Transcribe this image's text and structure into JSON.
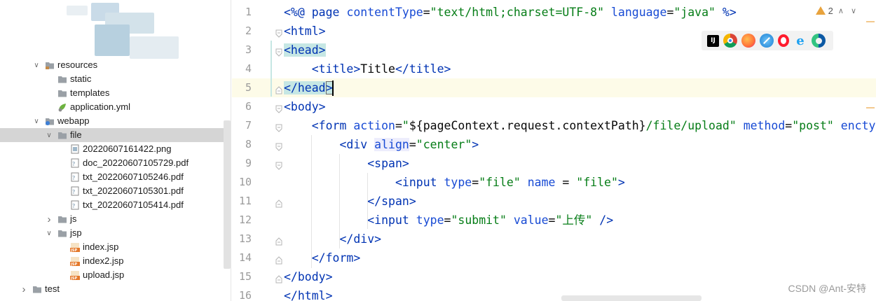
{
  "tree": {
    "items": [
      {
        "label": "resources",
        "indent": 1,
        "expanded": true,
        "kind": "folder-res"
      },
      {
        "label": "static",
        "indent": 2,
        "expanded": null,
        "kind": "folder"
      },
      {
        "label": "templates",
        "indent": 2,
        "expanded": null,
        "kind": "folder"
      },
      {
        "label": "application.yml",
        "indent": 2,
        "expanded": null,
        "kind": "yml"
      },
      {
        "label": "webapp",
        "indent": 1,
        "expanded": true,
        "kind": "folder-web"
      },
      {
        "label": "file",
        "indent": 2,
        "expanded": true,
        "kind": "folder",
        "selected": true
      },
      {
        "label": "20220607161422.png",
        "indent": 3,
        "expanded": null,
        "kind": "png"
      },
      {
        "label": "doc_20220607105729.pdf",
        "indent": 3,
        "expanded": null,
        "kind": "pdf"
      },
      {
        "label": "txt_20220607105246.pdf",
        "indent": 3,
        "expanded": null,
        "kind": "pdf"
      },
      {
        "label": "txt_20220607105301.pdf",
        "indent": 3,
        "expanded": null,
        "kind": "pdf"
      },
      {
        "label": "txt_20220607105414.pdf",
        "indent": 3,
        "expanded": null,
        "kind": "pdf"
      },
      {
        "label": "js",
        "indent": 2,
        "expanded": false,
        "kind": "folder"
      },
      {
        "label": "jsp",
        "indent": 2,
        "expanded": true,
        "kind": "folder"
      },
      {
        "label": "index.jsp",
        "indent": 3,
        "expanded": null,
        "kind": "jsp"
      },
      {
        "label": "index2.jsp",
        "indent": 3,
        "expanded": null,
        "kind": "jsp"
      },
      {
        "label": "upload.jsp",
        "indent": 3,
        "expanded": null,
        "kind": "jsp"
      },
      {
        "label": "test",
        "indent": 0,
        "expanded": false,
        "kind": "folder"
      }
    ]
  },
  "editor": {
    "line_numbers": [
      "1",
      "2",
      "3",
      "4",
      "5",
      "6",
      "7",
      "8",
      "9",
      "10",
      "11",
      "12",
      "13",
      "14",
      "15",
      "16"
    ],
    "warnings_count": "2",
    "browsers": [
      "intellij-icon",
      "chrome-icon",
      "firefox-icon",
      "safari-icon",
      "opera-icon",
      "ie-icon",
      "edge-icon"
    ]
  },
  "watermark": "CSDN @Ant-安特"
}
